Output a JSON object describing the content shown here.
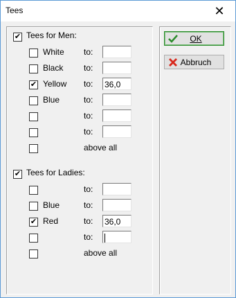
{
  "window": {
    "title": "Tees"
  },
  "men": {
    "header": "Tees for Men:",
    "header_checked": true,
    "rows": [
      {
        "label": "White",
        "checked": false,
        "to_label": "to:",
        "value": ""
      },
      {
        "label": "Black",
        "checked": false,
        "to_label": "to:",
        "value": ""
      },
      {
        "label": "Yellow",
        "checked": true,
        "to_label": "to:",
        "value": "36,0"
      },
      {
        "label": "Blue",
        "checked": false,
        "to_label": "to:",
        "value": ""
      },
      {
        "label": "",
        "checked": false,
        "to_label": "to:",
        "value": ""
      },
      {
        "label": "",
        "checked": false,
        "to_label": "to:",
        "value": ""
      }
    ],
    "above_all": "above all"
  },
  "ladies": {
    "header": "Tees for Ladies:",
    "header_checked": true,
    "rows": [
      {
        "label": "",
        "checked": false,
        "to_label": "to:",
        "value": ""
      },
      {
        "label": "Blue",
        "checked": false,
        "to_label": "to:",
        "value": ""
      },
      {
        "label": "Red",
        "checked": true,
        "to_label": "to:",
        "value": "36,0"
      },
      {
        "label": "",
        "checked": false,
        "to_label": "to:",
        "value": ""
      }
    ],
    "above_all": "above all"
  },
  "buttons": {
    "ok_label": "OK",
    "cancel_label": "Abbruch",
    "ok_icon": "checkmark-icon",
    "cancel_icon": "red-x-icon",
    "ok_icon_color": "#2a8b2a",
    "cancel_icon_color": "#d8281c"
  }
}
